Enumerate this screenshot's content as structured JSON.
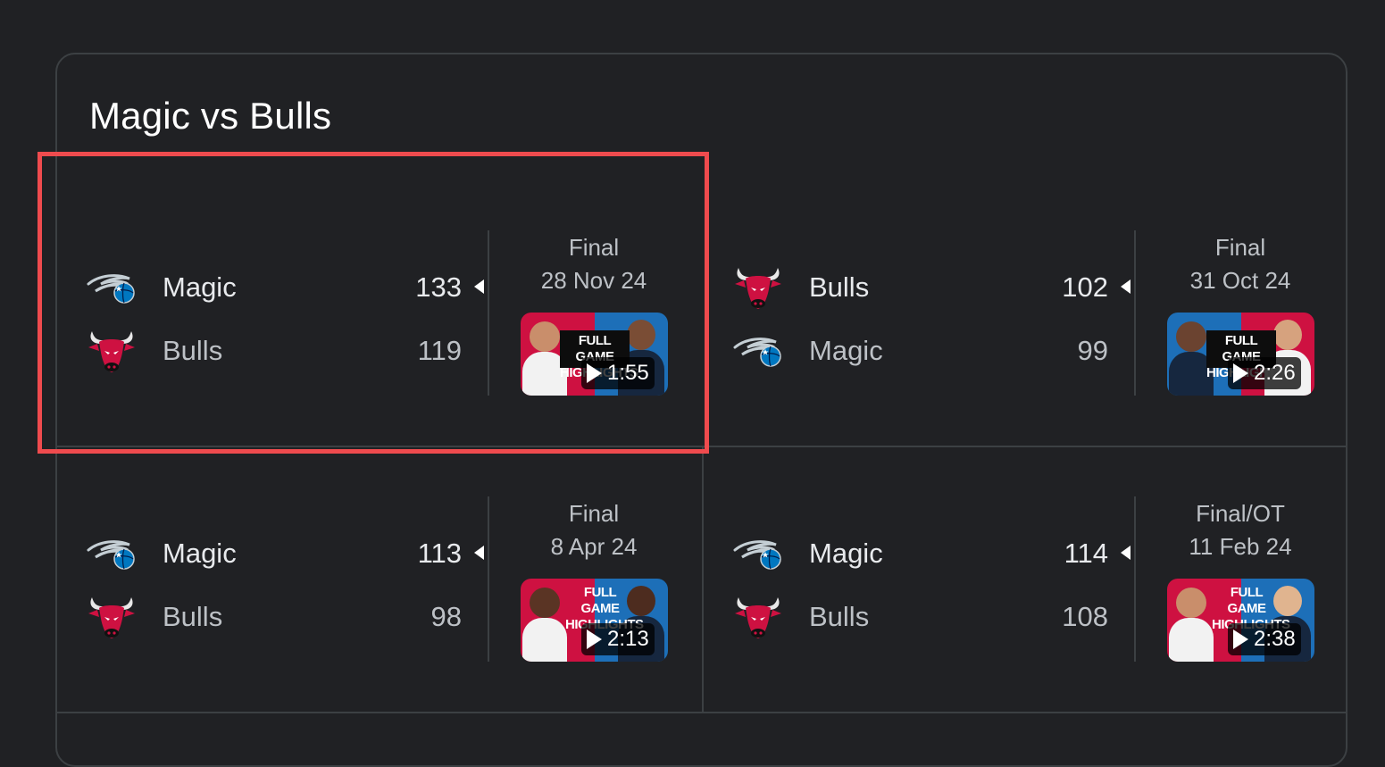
{
  "card": {
    "title": "Magic vs Bulls"
  },
  "colors": {
    "background": "#202124",
    "divider": "#3c4043",
    "highlight": "#ef4b4e",
    "bulls_red": "#ce1141",
    "magic_blue": "#0077c0"
  },
  "games": [
    {
      "team1": {
        "name": "Magic",
        "score": "133",
        "icon": "magic-logo-icon",
        "winner": true
      },
      "team2": {
        "name": "Bulls",
        "score": "119",
        "icon": "bulls-logo-icon",
        "winner": false
      },
      "status": "Final",
      "date": "28 Nov 24",
      "video": {
        "duration": "1:55",
        "banner": "FULL GAME HIGHLIGHTS"
      }
    },
    {
      "team1": {
        "name": "Bulls",
        "score": "102",
        "icon": "bulls-logo-icon",
        "winner": true
      },
      "team2": {
        "name": "Magic",
        "score": "99",
        "icon": "magic-logo-icon",
        "winner": false
      },
      "status": "Final",
      "date": "31 Oct 24",
      "video": {
        "duration": "2:26",
        "banner": "FULL GAME HIGHLIGHTS"
      }
    },
    {
      "team1": {
        "name": "Magic",
        "score": "113",
        "icon": "magic-logo-icon",
        "winner": true
      },
      "team2": {
        "name": "Bulls",
        "score": "98",
        "icon": "bulls-logo-icon",
        "winner": false
      },
      "status": "Final",
      "date": "8 Apr 24",
      "video": {
        "duration": "2:13",
        "banner": "FULL GAME HIGHLIGHTS"
      }
    },
    {
      "team1": {
        "name": "Magic",
        "score": "114",
        "icon": "magic-logo-icon",
        "winner": true
      },
      "team2": {
        "name": "Bulls",
        "score": "108",
        "icon": "bulls-logo-icon",
        "winner": false
      },
      "status": "Final/OT",
      "date": "11 Feb 24",
      "video": {
        "duration": "2:38",
        "banner": "FULL GAME HIGHLIGHTS"
      }
    }
  ]
}
